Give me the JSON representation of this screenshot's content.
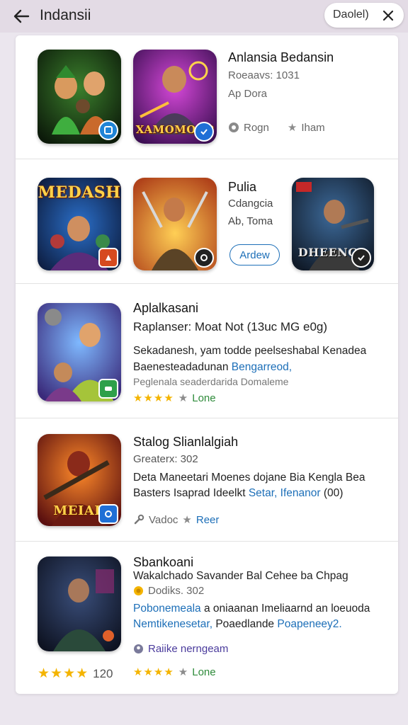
{
  "header": {
    "title": "Indansii",
    "action_label": "Daolel)",
    "back_icon": "arrow-left-icon",
    "close_icon": "close-icon"
  },
  "colors": {
    "accent": "#1d6fb8",
    "rating": "#f4b400",
    "green_text": "#2e8b3a",
    "header_bg": "#e3dbe5"
  },
  "row1": {
    "icon2_caption": "XAMOMOUP",
    "title": "Anlansia Bedansin",
    "line1": "Roeaavs: 1031",
    "line2": "Ap Dora",
    "meta1": "Rogn",
    "meta2": "Iham"
  },
  "row2": {
    "icon1_caption": "MEDASH",
    "icon4_caption": "DHEENGR",
    "title": "Pulia",
    "line1": "Cdangcia",
    "line2": "Ab, Toma",
    "button_label": "Ardew"
  },
  "row3": {
    "title": "Aplalkasani",
    "subtitle": "Raplanser: Moat Not (13uc MG e0g)",
    "desc1_a": "Sekadanesh, yam todde peelseshabal Kenadea",
    "desc2_a": "Baenesteadadunan",
    "desc2_b": "Bengarreod,",
    "desc3": "Peglenala seaderdarida Domaleme",
    "rating_label": "Lone"
  },
  "row4": {
    "icon_caption": "MEIAR",
    "title": "Stalog Slianlalgiah",
    "line1": "Greaterx: 302",
    "desc1": "Deta Maneetari Moenes dojane Bia Kengla Bea",
    "desc2_a": "Basters Isaprad Ideelkt",
    "desc2_b": "Setar, Ifenanor",
    "desc2_c": "(00)",
    "meta1": "Vadoc",
    "meta2": "Reer"
  },
  "row5": {
    "title": "Sbankoani",
    "line1": "Wakalchado Savander Bal Cehee ba Chpag",
    "line2": "Dodiks. 302",
    "desc1_a": "Pobonemeala",
    "desc1_b": "a oniaanan Imeliaarnd an loeuoda",
    "desc2_a": "Nemtikenesetar,",
    "desc2_b": "Poaedlande",
    "desc2_c": "Poapeneey2.",
    "author": "Raiike nerngeam",
    "rating_count": "120",
    "rating_label": "Lone"
  }
}
